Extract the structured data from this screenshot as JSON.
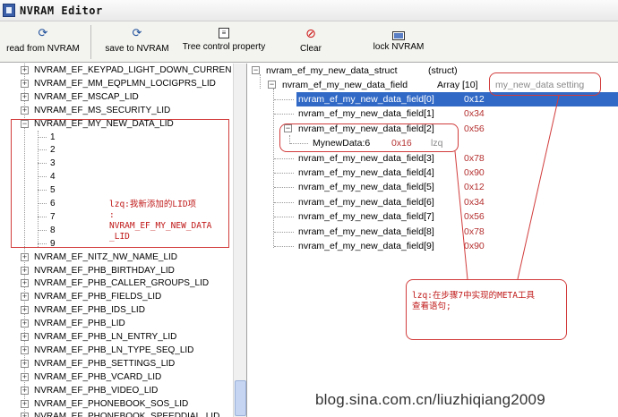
{
  "window": {
    "title": "NVRAM Editor"
  },
  "toolbar": {
    "read": "read from NVRAM",
    "save": "save to NVRAM",
    "tree": "Tree control property",
    "clear": "Clear",
    "lock": "lock NVRAM"
  },
  "left_tree": {
    "items_top": [
      "NVRAM_EF_KEYPAD_LIGHT_DOWN_CURREN",
      "NVRAM_EF_MM_EQPLMN_LOCIGPRS_LID",
      "NVRAM_EF_MSCAP_LID",
      "NVRAM_EF_MS_SECURITY_LID",
      "NVRAM_EF_MY_NEW_DATA_LID"
    ],
    "children": [
      "1",
      "2",
      "3",
      "4",
      "5",
      "6",
      "7",
      "8",
      "9"
    ],
    "items_bottom": [
      "NVRAM_EF_NITZ_NW_NAME_LID",
      "NVRAM_EF_PHB_BIRTHDAY_LID",
      "NVRAM_EF_PHB_CALLER_GROUPS_LID",
      "NVRAM_EF_PHB_FIELDS_LID",
      "NVRAM_EF_PHB_IDS_LID",
      "NVRAM_EF_PHB_LID",
      "NVRAM_EF_PHB_LN_ENTRY_LID",
      "NVRAM_EF_PHB_LN_TYPE_SEQ_LID",
      "NVRAM_EF_PHB_SETTINGS_LID",
      "NVRAM_EF_PHB_VCARD_LID",
      "NVRAM_EF_PHB_VIDEO_LID",
      "NVRAM_EF_PHONEBOOK_SOS_LID",
      "NVRAM_EF_PHONEBOOK_SPEEDDIAL_LID"
    ]
  },
  "right_tree": {
    "root": {
      "name": "nvram_ef_my_new_data_struct",
      "type": "(struct)"
    },
    "field": {
      "name": "nvram_ef_my_new_data_field",
      "type": "Array [10]",
      "desc": "my_new_data setting"
    },
    "entries": [
      {
        "name": "nvram_ef_my_new_data_field[0]",
        "value": "0x12"
      },
      {
        "name": "nvram_ef_my_new_data_field[1]",
        "value": "0x34"
      },
      {
        "name": "nvram_ef_my_new_data_field[2]",
        "value": "0x56"
      },
      {
        "name": "nvram_ef_my_new_data_field[3]",
        "value": "0x78"
      },
      {
        "name": "nvram_ef_my_new_data_field[4]",
        "value": "0x90"
      },
      {
        "name": "nvram_ef_my_new_data_field[5]",
        "value": "0x12"
      },
      {
        "name": "nvram_ef_my_new_data_field[6]",
        "value": "0x34"
      },
      {
        "name": "nvram_ef_my_new_data_field[7]",
        "value": "0x56"
      },
      {
        "name": "nvram_ef_my_new_data_field[8]",
        "value": "0x78"
      },
      {
        "name": "nvram_ef_my_new_data_field[9]",
        "value": "0x90"
      }
    ],
    "sub": {
      "name": "MynewData:6",
      "value": "0x16",
      "desc": "lzq"
    }
  },
  "annotations": {
    "left_note_line1": "lzq:我新添加的LID项",
    "left_note_line2": ":",
    "left_note_line3": "NVRAM_EF_MY_NEW_DATA",
    "left_note_line4": "_LID",
    "right_note_line1": "lzq:在步骤7中实现的META工具",
    "right_note_line2": "查看语句;"
  },
  "watermark": "blog.sina.com.cn/liuzhiqiang2009",
  "colors": {
    "selection": "#3169c6",
    "annotation": "#d23c3c",
    "hex_value": "#b53030"
  }
}
